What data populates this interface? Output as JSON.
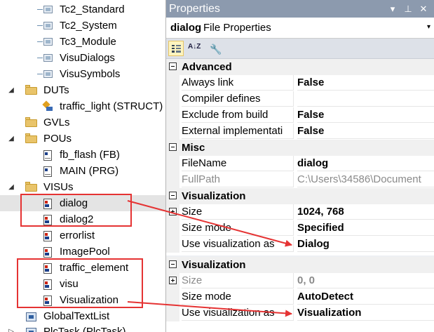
{
  "tree": {
    "items": [
      {
        "label": "Tc2_Standard",
        "icon": "library-icon"
      },
      {
        "label": "Tc2_System",
        "icon": "library-icon"
      },
      {
        "label": "Tc3_Module",
        "icon": "library-icon"
      },
      {
        "label": "VisuDialogs",
        "icon": "library-icon"
      },
      {
        "label": "VisuSymbols",
        "icon": "library-icon"
      },
      {
        "label": "DUTs",
        "icon": "folder-icon",
        "expander": "◢"
      },
      {
        "label": "traffic_light (STRUCT)",
        "icon": "struct-icon"
      },
      {
        "label": "GVLs",
        "icon": "folder-icon",
        "expander": "▷"
      },
      {
        "label": "POUs",
        "icon": "folder-icon",
        "expander": "◢"
      },
      {
        "label": "fb_flash (FB)",
        "icon": "pou-icon"
      },
      {
        "label": "MAIN (PRG)",
        "icon": "pou-icon"
      },
      {
        "label": "VISUs",
        "icon": "folder-icon",
        "expander": "◢"
      },
      {
        "label": "dialog",
        "icon": "visualization-icon"
      },
      {
        "label": "dialog2",
        "icon": "visualization-icon"
      },
      {
        "label": "errorlist",
        "icon": "visualization-icon"
      },
      {
        "label": "ImagePool",
        "icon": "visualization-icon"
      },
      {
        "label": "traffic_element",
        "icon": "visualization-icon"
      },
      {
        "label": "visu",
        "icon": "visualization-icon"
      },
      {
        "label": "Visualization",
        "icon": "visualization-icon"
      },
      {
        "label": "GlobalTextList",
        "icon": "textlist-icon"
      },
      {
        "label": "PlcTask (PlcTask)",
        "icon": "task-icon"
      }
    ]
  },
  "properties": {
    "title": "Properties",
    "title_buttons": {
      "dropdown": "▾",
      "pin": "⊥",
      "close": "✕"
    },
    "object_name": "dialog",
    "object_kind": "File Properties",
    "object_dropdown": "▾",
    "toolbar": {
      "categorized_icon": "categorized-icon",
      "alphabetical_icon": "sort-az-icon",
      "alphabetical_glyph": "A↓Z",
      "property_pages_icon": "wrench-icon",
      "wrench_glyph": "🔧"
    },
    "categories": [
      {
        "name": "Advanced",
        "rows": [
          {
            "name": "Always link",
            "value": "False"
          },
          {
            "name": "Compiler defines",
            "value": ""
          },
          {
            "name": "Exclude from build",
            "value": "False"
          },
          {
            "name": "External implementati",
            "value": "False"
          }
        ]
      },
      {
        "name": "Misc",
        "rows": [
          {
            "name": "FileName",
            "value": "dialog"
          },
          {
            "name": "FullPath",
            "value": "C:\\Users\\34586\\Document"
          }
        ]
      },
      {
        "name": "Visualization",
        "rows": [
          {
            "name": "Size",
            "value": "1024, 768"
          },
          {
            "name": "Size mode",
            "value": "Specified"
          },
          {
            "name": "Use visualization as",
            "value": "Dialog"
          }
        ]
      }
    ],
    "second": {
      "category": "Visualization",
      "rows": [
        {
          "name": "Size",
          "value": "0, 0"
        },
        {
          "name": "Size mode",
          "value": "AutoDetect"
        },
        {
          "name": "Use visualization as",
          "value": "Visualization"
        }
      ]
    }
  },
  "colors": {
    "annotation": "#e53333",
    "title_bar": "#8c9aae",
    "toolbar": "#dde1e8",
    "selection": "#e4e4e4"
  }
}
